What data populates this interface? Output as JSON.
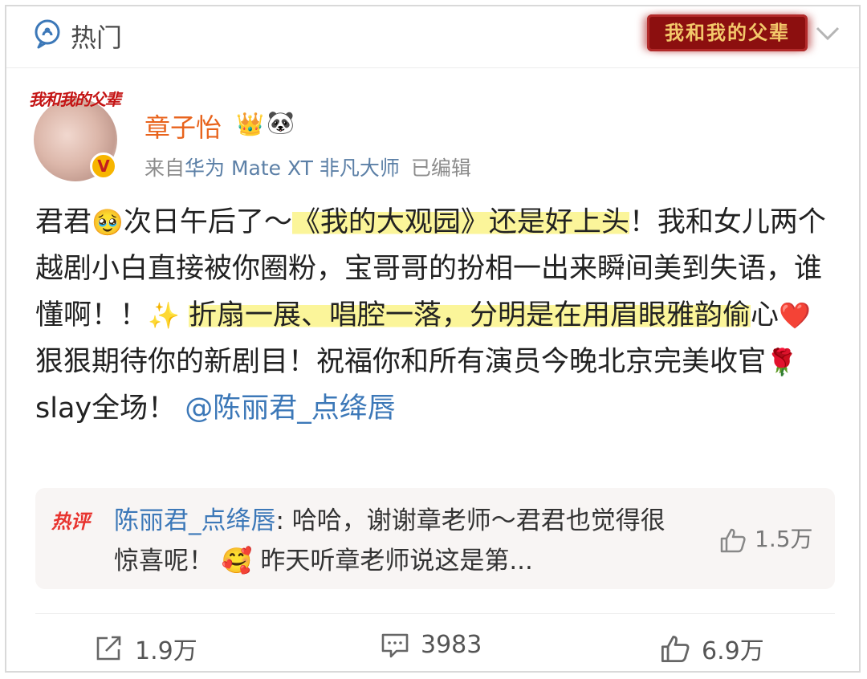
{
  "header": {
    "section_label": "热门",
    "banner_text": "我和我的父辈"
  },
  "author": {
    "avatar_caption": "我和我的父辈",
    "verified_mark": "V",
    "name": "章子怡",
    "name_emojis": [
      "👑",
      "🐼"
    ],
    "source_prefix": "来自",
    "device": "华为 Mate XT 非凡大师",
    "edited": "已编辑"
  },
  "post": {
    "p1": "君君",
    "e1": "🥹",
    "p2": "次日午后了～",
    "hl1": "《我的大观园》还是好上头",
    "p3": "！我和女儿两个越剧小白直接被你圈粉，宝哥哥的扮相一出来瞬间美到失语，谁懂啊！！",
    "e2": "✨",
    "hl2": "折扇一展、唱腔一落，分明是在用眉眼雅韵偷",
    "p4": "心",
    "e3": "❤️",
    "p5": "狠狠期待你的新剧目！祝福你和所有演员今晚北京完美收官",
    "e4": "🌹",
    "p6": "slay全场！",
    "mention": "@陈丽君_点绛唇"
  },
  "hot_comment": {
    "tag": "热评",
    "author": "陈丽君_点绛唇",
    "text1": ": 哈哈，谢谢章老师～君君也觉得很惊喜呢！",
    "emoji": "🥰",
    "text2": "昨天听章老师说这是第...",
    "likes": "1.5万"
  },
  "actions": {
    "repost": "1.9万",
    "comments": "3983",
    "likes": "6.9万"
  },
  "colors": {
    "username": "#e8631c",
    "link": "#3c78b8",
    "highlight": "#fbf59a",
    "hot_tag": "#e8342f"
  }
}
